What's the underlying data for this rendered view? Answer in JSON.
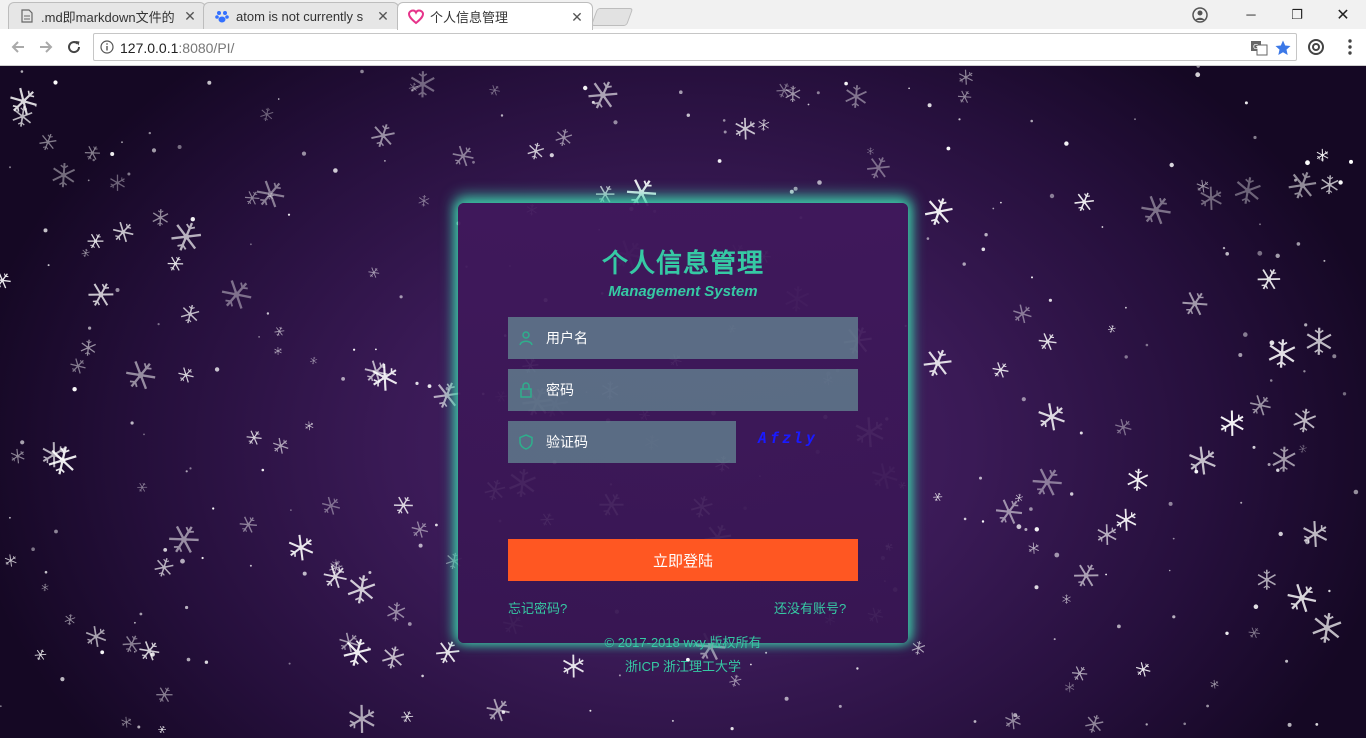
{
  "browser": {
    "tabs": [
      {
        "title": ".md即markdown文件的",
        "icon": "document-icon"
      },
      {
        "title": "atom is not currently s",
        "icon": "baidu-paw-icon"
      },
      {
        "title": "个人信息管理",
        "icon": "heart-icon",
        "active": true
      }
    ],
    "tab_close_glyph": "✕",
    "window_controls": {
      "minimize": "─",
      "maximize": "❐",
      "close": "✕"
    },
    "url_host": "127.0.0.1",
    "url_path": ":8080/PI/"
  },
  "page": {
    "title": "个人信息管理",
    "subtitle": "Management System",
    "username_placeholder": "用户名",
    "password_placeholder": "密码",
    "captcha_placeholder": "验证码",
    "captcha_text": "Afzly",
    "login_button": "立即登陆",
    "forgot_password": "忘记密码?",
    "register_link": "还没有账号?",
    "copyright": "© 2017-2018 wxy 版权所有",
    "icp": "浙ICP 浙江理工大学"
  },
  "colors": {
    "accent": "#36c9a4",
    "button": "#ff5722",
    "background": "#3a1a56",
    "captcha": "#1a1aff"
  }
}
